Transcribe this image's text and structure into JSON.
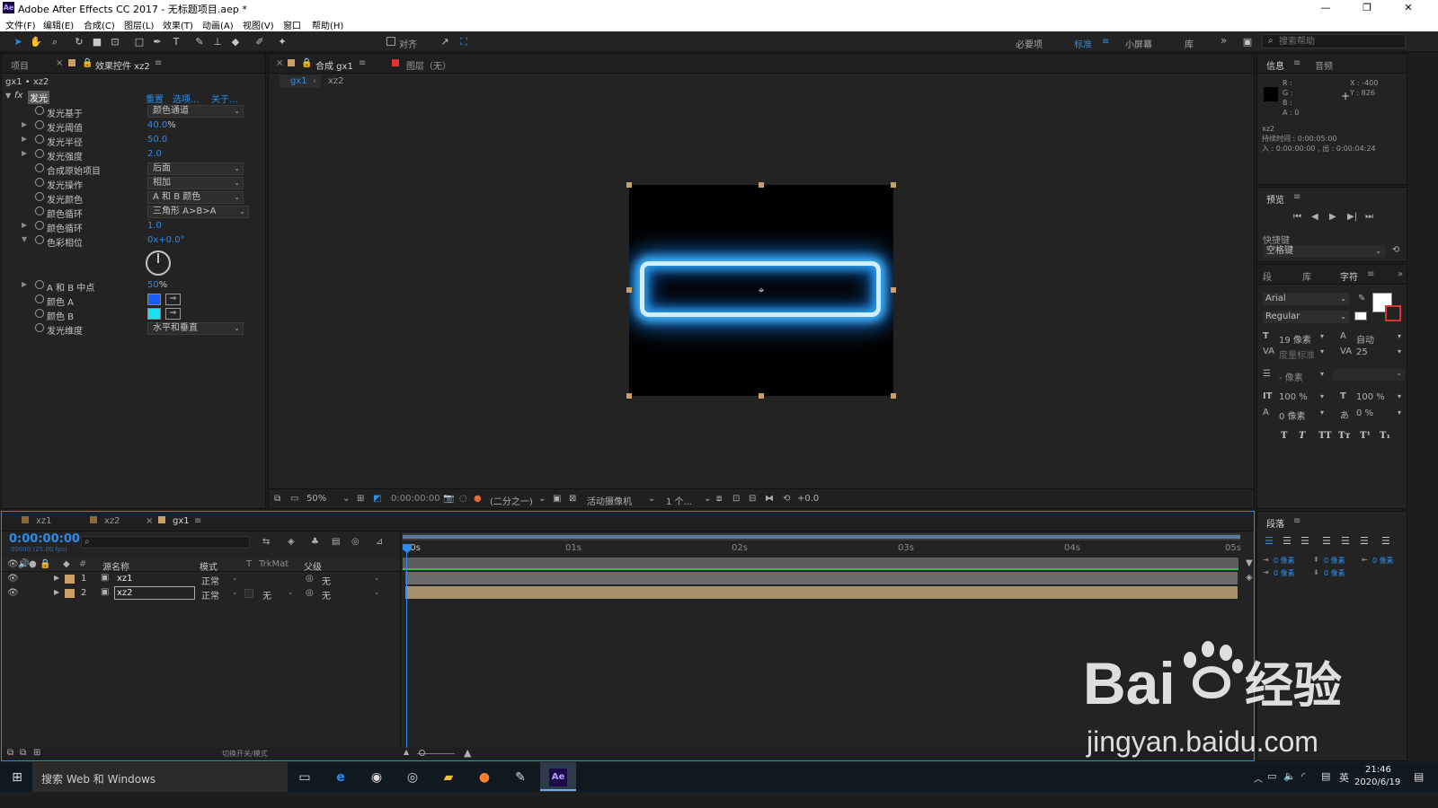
{
  "app": {
    "logo": "Ae",
    "title": "Adobe After Effects CC 2017 - 无标题项目.aep *"
  },
  "window_buttons": {
    "minimize": "—",
    "maximize": "❐",
    "close": "✕"
  },
  "menu": [
    "文件(F)",
    "编辑(E)",
    "合成(C)",
    "图层(L)",
    "效果(T)",
    "动画(A)",
    "视图(V)",
    "窗口",
    "帮助(H)"
  ],
  "toolbar": {
    "tool_icons": [
      "selection-icon",
      "hand-icon",
      "zoom-icon",
      "rotate-icon",
      "camera-icon",
      "pan-behind-icon",
      "rectangle-icon",
      "pen-icon",
      "type-icon",
      "brush-icon",
      "clone-stamp-icon",
      "eraser-icon",
      "roto-brush-icon",
      "puppet-pin-icon"
    ],
    "snap_label": "对齐",
    "workspaces": [
      "必要项",
      "标准",
      "小屏幕",
      "库"
    ],
    "active_workspace": "标准",
    "search_placeholder": "搜索帮助"
  },
  "left_panel": {
    "tabs": [
      "项目",
      "效果控件 xz2"
    ],
    "tab_layer": "xz2",
    "breadcrumb": "gx1 • xz2",
    "effect": {
      "fx": "fx",
      "name": "发光",
      "links": [
        "重置",
        "选项...",
        "关于..."
      ]
    },
    "properties": [
      {
        "name": "发光基于",
        "type": "dropdown",
        "value": "颜色通道"
      },
      {
        "name": "发光阈值",
        "type": "value",
        "value": "40.0",
        "unit": "%",
        "twirl": "▶"
      },
      {
        "name": "发光半径",
        "type": "value",
        "value": "50.0",
        "twirl": "▶"
      },
      {
        "name": "发光强度",
        "type": "value",
        "value": "2.0",
        "twirl": "▶"
      },
      {
        "name": "合成原始项目",
        "type": "dropdown",
        "value": "后面"
      },
      {
        "name": "发光操作",
        "type": "dropdown",
        "value": "相加"
      },
      {
        "name": "发光颜色",
        "type": "dropdown",
        "value": "A 和 B 颜色"
      },
      {
        "name": "颜色循环",
        "type": "dropdown",
        "value": "三角形 A>B>A"
      },
      {
        "name": "颜色循环",
        "type": "value",
        "value": "1.0",
        "twirl": "▶"
      },
      {
        "name": "色彩相位",
        "type": "value",
        "value": "0x+0.0°",
        "twirl": "▼"
      },
      {
        "name": "A 和 B 中点",
        "type": "value",
        "value": "50",
        "unit": "%",
        "twirl": "▶"
      },
      {
        "name": "颜色 A",
        "type": "color",
        "value": "#1a5cff"
      },
      {
        "name": "颜色 B",
        "type": "color",
        "value": "#19e3f0"
      },
      {
        "name": "发光维度",
        "type": "dropdown",
        "value": "水平和垂直"
      }
    ]
  },
  "viewer": {
    "tabs": [
      "合成 gx1",
      "图层（无）"
    ],
    "tab_comp_name": "gx1",
    "flow": [
      "gx1",
      "xz2"
    ],
    "bottom": {
      "zoom": "50%",
      "timecode": "0:00:00:00",
      "resolution": "(二分之一)",
      "camera": "活动摄像机",
      "views": "1 个...",
      "exposure": "+0.0"
    }
  },
  "info_panel": {
    "tabs": [
      "信息",
      "音频"
    ],
    "rgba": [
      "R :",
      "G :",
      "B :",
      "A : 0"
    ],
    "coords": [
      "X : -400",
      "Y : 826"
    ],
    "layer_name": "xz2",
    "duration": "持续时间 : 0:00:05:00",
    "in_out": "入 : 0:00:00:00 , 出 : 0:00:04:24"
  },
  "preview_panel": {
    "title": "预览",
    "shortcut_label": "快捷键",
    "shortcut_value": "空格键"
  },
  "character_panel": {
    "tabs": [
      "段",
      "库",
      "字符"
    ],
    "font": "Arial",
    "style": "Regular",
    "size": "19 像素",
    "leading": "自动",
    "kerning": "度量标准",
    "tracking": "25",
    "stroke": "- 像素",
    "vscale": "100 %",
    "hscale": "100 %",
    "baseline": "0 像素",
    "tsume": "0 %",
    "styles": [
      "T",
      "T",
      "TT",
      "Tт",
      "T¹",
      "T₁"
    ]
  },
  "paragraph_panel": {
    "title": "段落",
    "indents": [
      "0 像素",
      "0 像素",
      "0 像素",
      "0 像素",
      "0 像素"
    ]
  },
  "timeline": {
    "tabs": [
      "xz1",
      "xz2",
      "gx1"
    ],
    "tab_colors": [
      "#8a6a3a",
      "#8a6a3a",
      "#c9a06a"
    ],
    "timecode": "0:00:00:00",
    "fps": "00000 (25.00 fps)",
    "columns": [
      "#",
      "源名称",
      "模式",
      "T",
      "TrkMat",
      "父级"
    ],
    "layers": [
      {
        "num": "1",
        "name": "xz1",
        "mode": "正常",
        "trkmat": "",
        "parent": "无"
      },
      {
        "num": "2",
        "name": "xz2",
        "mode": "正常",
        "trkmat": "无",
        "parent": "无"
      }
    ],
    "ruler": [
      "00s",
      "01s",
      "02s",
      "03s",
      "04s",
      "05s"
    ],
    "footer": "切换开关/模式"
  },
  "taskbar": {
    "search": "搜索 Web 和 Windows",
    "time": "21:46",
    "date": "2020/6/19",
    "lang": "英"
  },
  "watermark": {
    "brand": "Bai",
    "brand2": "经验",
    "url": "jingyan.baidu.com"
  }
}
